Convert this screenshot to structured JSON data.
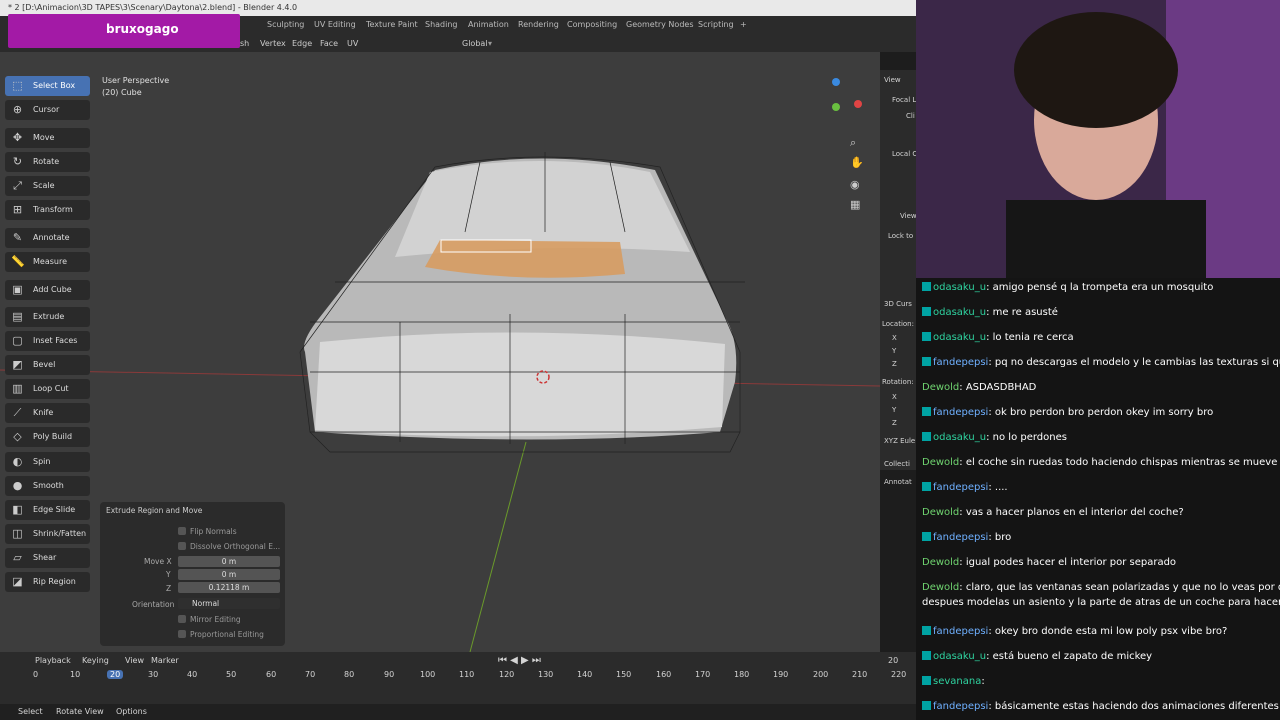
{
  "window": {
    "title": "* 2 [D:\\Animacion\\3D TAPES\\3\\Scenary\\Daytona\\2.blend] - Blender 4.4.0"
  },
  "overlay_logo": {
    "name": "bruxogago",
    "color": "#a31aa6"
  },
  "workspace_tabs": [
    "Sculpting",
    "UV Editing",
    "Texture Paint",
    "Shading",
    "Animation",
    "Rendering",
    "Compositing",
    "Geometry Nodes",
    "Scripting",
    "+"
  ],
  "header_menu": [
    "sh",
    "Vertex",
    "Edge",
    "Face",
    "UV"
  ],
  "transform_orientation": "Global",
  "viewport": {
    "perspective": "User Perspective",
    "object": "(20) Cube"
  },
  "tools": [
    "Select Box",
    "Cursor",
    "Move",
    "Rotate",
    "Scale",
    "Transform",
    "Annotate",
    "Measure",
    "Add Cube",
    "Extrude Region",
    "Inset Faces",
    "Bevel",
    "Loop Cut",
    "Knife",
    "Poly Build",
    "Spin",
    "Smooth",
    "Edge Slide",
    "Shrink/Fatten",
    "Shear",
    "Rip Region"
  ],
  "npanel": {
    "view": "View",
    "focal": "Focal L",
    "clip": "Cli",
    "local": "Local C",
    "view2": "View",
    "lock": "Lock to",
    "cursor": "3D Curs",
    "location": "Location:",
    "x": "X",
    "y": "Y",
    "z": "Z",
    "rotation": "Rotation:",
    "rx": "X",
    "ry": "Y",
    "rz": "Z",
    "euler": "XYZ Eule",
    "collections": "Collecti",
    "annotations": "Annotat"
  },
  "operator_panel": {
    "title": "Extrude Region and Move",
    "flip_normals": "Flip Normals",
    "dissolve": "Dissolve Orthogonal E...",
    "move_x_label": "Move X",
    "move_y_label": "Y",
    "move_z_label": "Z",
    "move_x": "0 m",
    "move_y": "0 m",
    "move_z": "0.12118 m",
    "orientation_label": "Orientation",
    "orientation": "Normal",
    "mirror": "Mirror Editing",
    "proportional": "Proportional Editing"
  },
  "timeline": {
    "menus": [
      "Playback",
      "Keying",
      "View",
      "Marker"
    ],
    "current_frame": "20",
    "ticks": [
      "0",
      "10",
      "20",
      "30",
      "40",
      "50",
      "60",
      "70",
      "80",
      "90",
      "100",
      "110",
      "120",
      "130",
      "140",
      "150",
      "160",
      "170",
      "180",
      "190",
      "200",
      "210",
      "220"
    ]
  },
  "statusbar": {
    "select": "Select",
    "rotate": "Rotate View",
    "options": "Options"
  },
  "chat": [
    {
      "user": "odasaku_u",
      "text": "amigo pensé q la trompeta era un mosquito",
      "badge": true
    },
    {
      "user": "odasaku_u",
      "text": "me re asusté",
      "badge": true
    },
    {
      "user": "odasaku_u",
      "text": "lo tenia re cerca",
      "badge": true
    },
    {
      "user": "fandepepsi",
      "text": "pq no descargas el modelo y le cambias las texturas si queres",
      "badge": true
    },
    {
      "user": "Dewold",
      "text": "ASDASDBHAD",
      "badge": false
    },
    {
      "user": "fandepepsi",
      "text": "ok bro perdon bro perdon okey im sorry bro",
      "badge": true
    },
    {
      "user": "odasaku_u",
      "text": "no lo perdones",
      "badge": true
    },
    {
      "user": "Dewold",
      "text": "el coche sin ruedas todo haciendo chispas mientras se mueve",
      "badge": false
    },
    {
      "user": "fandepepsi",
      "text": "....",
      "badge": true
    },
    {
      "user": "Dewold",
      "text": "vas a hacer planos en el interior del coche?",
      "badge": false
    },
    {
      "user": "fandepepsi",
      "text": "bro",
      "badge": true
    },
    {
      "user": "Dewold",
      "text": "igual podes hacer el interior por separado",
      "badge": false
    },
    {
      "user": "Dewold",
      "text": "claro, que las ventanas sean polarizadas y que no lo veas por dentro y",
      "badge": false
    },
    {
      "user": "",
      "text": "despues modelas un asiento y la parte de atras de un coche para hacer el interior",
      "badge": false
    },
    {
      "user": "fandepepsi",
      "text": "okey bro donde esta mi low poly psx vibe bro?",
      "badge": true
    },
    {
      "user": "odasaku_u",
      "text": "está bueno el zapato de mickey",
      "badge": true
    },
    {
      "user": "sevanana",
      "text": "",
      "badge": true
    },
    {
      "user": "fandepepsi",
      "text": "básicamente estas haciendo dos animaciones diferentes no",
      "badge": true
    }
  ]
}
